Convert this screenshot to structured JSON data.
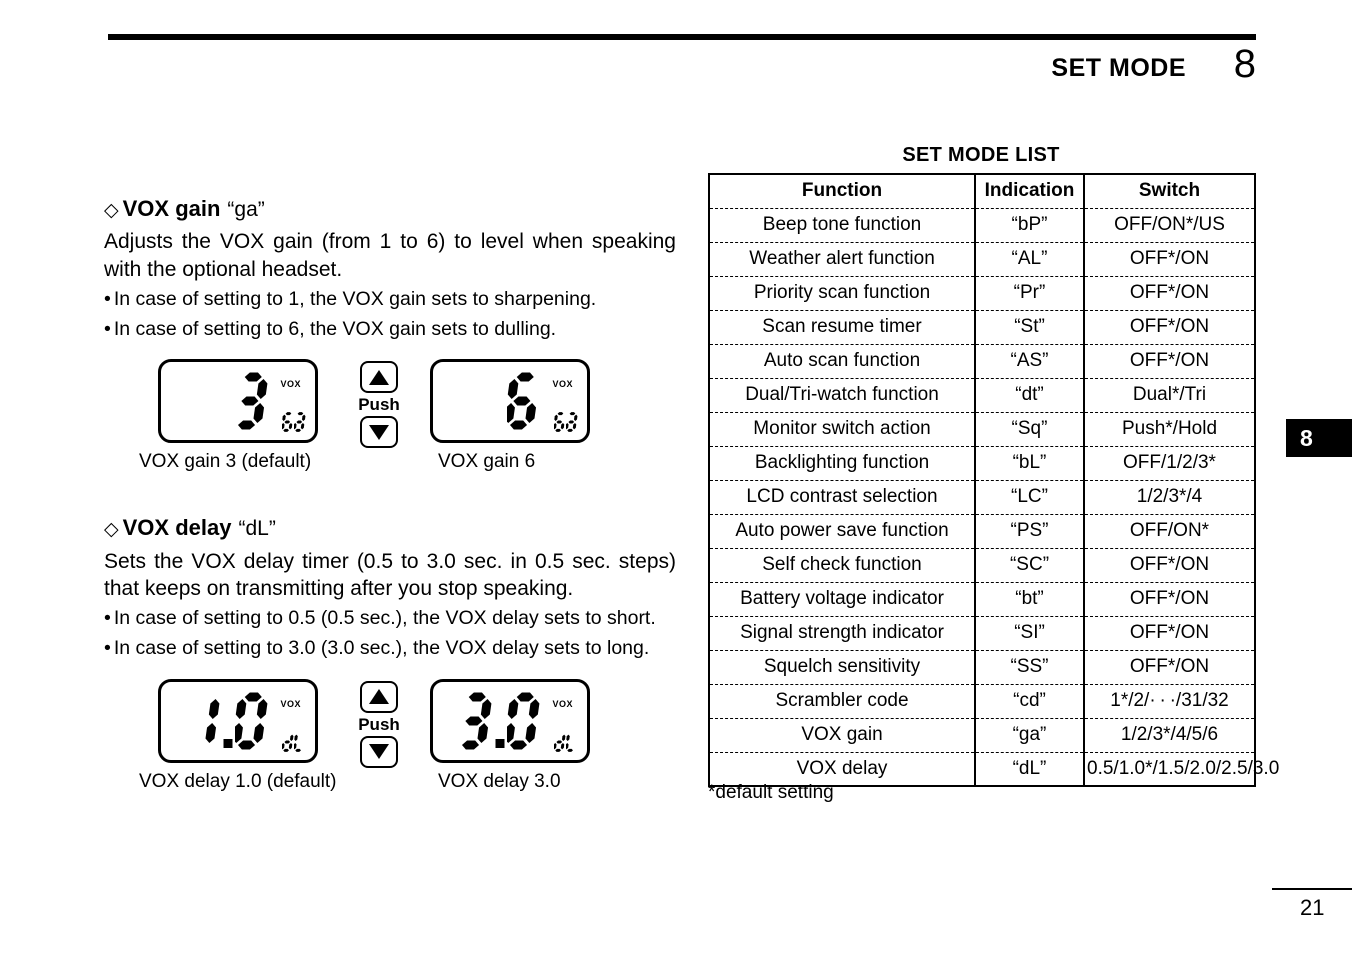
{
  "header": {
    "title": "SET MODE",
    "chapter": "8"
  },
  "margin_tab": {
    "label": "8"
  },
  "footer": {
    "page_number": "21"
  },
  "sections": [
    {
      "diamond": "◇",
      "heading": "VOX gain",
      "code": "“ga”",
      "body": "Adjusts the VOX gain (from 1 to 6) to level when speaking with the optional headset.",
      "bullets": [
        "In case of setting to 1, the VOX gain sets to sharpening.",
        "In case of setting to 6, the VOX gain sets to dulling."
      ],
      "figures": {
        "left": {
          "value": "3",
          "unit": "ga",
          "vox": "VOX",
          "caption": "VOX gain 3 (default)"
        },
        "right": {
          "value": "6",
          "unit": "ga",
          "vox": "VOX",
          "caption": "VOX gain 6"
        },
        "push_label": "Push",
        "up_icon": "triangle-up-icon",
        "down_icon": "triangle-down-icon"
      }
    },
    {
      "diamond": "◇",
      "heading": "VOX delay",
      "code": "“dL”",
      "body": "Sets the VOX delay timer (0.5 to 3.0 sec. in 0.5 sec. steps) that keeps on transmitting after you stop speaking.",
      "bullets": [
        "In case of setting to 0.5 (0.5 sec.), the VOX delay sets to short.",
        "In case of setting to 3.0 (3.0 sec.), the VOX delay sets to long."
      ],
      "figures": {
        "left": {
          "value": "1.0",
          "unit": "dL",
          "vox": "VOX",
          "caption": "VOX delay 1.0 (default)"
        },
        "right": {
          "value": "3.0",
          "unit": "dL",
          "vox": "VOX",
          "caption": "VOX delay 3.0"
        },
        "push_label": "Push",
        "up_icon": "triangle-up-icon",
        "down_icon": "triangle-down-icon"
      }
    }
  ],
  "table": {
    "title": "SET MODE LIST",
    "columns": [
      "Function",
      "Indication",
      "Switch"
    ],
    "rows": [
      {
        "function": "Beep tone function",
        "indication": "“bP”",
        "switch": "OFF/ON*/US"
      },
      {
        "function": "Weather alert function",
        "indication": "“AL”",
        "switch": "OFF*/ON"
      },
      {
        "function": "Priority scan function",
        "indication": "“Pr”",
        "switch": "OFF*/ON"
      },
      {
        "function": "Scan resume timer",
        "indication": "“St”",
        "switch": "OFF*/ON"
      },
      {
        "function": "Auto scan function",
        "indication": "“AS”",
        "switch": "OFF*/ON"
      },
      {
        "function": "Dual/Tri-watch function",
        "indication": "“dt”",
        "switch": "Dual*/Tri"
      },
      {
        "function": "Monitor switch action",
        "indication": "“Sq”",
        "switch": "Push*/Hold"
      },
      {
        "function": "Backlighting function",
        "indication": "“bL”",
        "switch": "OFF/1/2/3*"
      },
      {
        "function": "LCD contrast selection",
        "indication": "“LC”",
        "switch": "1/2/3*/4"
      },
      {
        "function": "Auto power save function",
        "indication": "“PS”",
        "switch": "OFF/ON*"
      },
      {
        "function": "Self check function",
        "indication": "“SC”",
        "switch": "OFF*/ON"
      },
      {
        "function": "Battery voltage indicator",
        "indication": "“bt”",
        "switch": "OFF*/ON"
      },
      {
        "function": "Signal strength indicator",
        "indication": "“SI”",
        "switch": "OFF*/ON"
      },
      {
        "function": "Squelch sensitivity",
        "indication": "“SS”",
        "switch": "OFF*/ON"
      },
      {
        "function": "Scrambler code",
        "indication": "“cd”",
        "switch": "1*/2/· · ·/31/32"
      },
      {
        "function": "VOX gain",
        "indication": "“ga”",
        "switch": "1/2/3*/4/5/6"
      },
      {
        "function": "VOX delay",
        "indication": "“dL”",
        "switch": "0.5/1.0*/1.5/2.0/2.5/3.0"
      }
    ],
    "footnote": "*default setting"
  }
}
